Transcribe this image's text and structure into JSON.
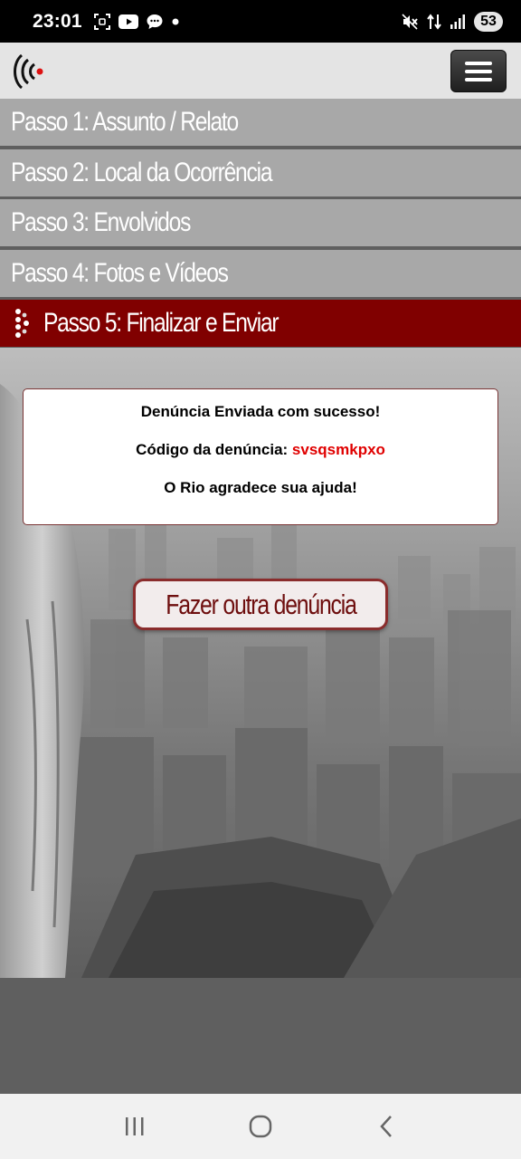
{
  "status_bar": {
    "time": "23:01",
    "battery": "53",
    "icons_left": [
      "screenshot-icon",
      "youtube-icon",
      "chat-icon",
      "dot-icon"
    ],
    "icons_right": [
      "mute-icon",
      "data-arrows-icon",
      "signal-icon",
      "battery-icon"
    ]
  },
  "header": {
    "logo_icon": "sound-waves-logo-icon",
    "menu_icon": "hamburger-menu-icon"
  },
  "steps": [
    {
      "label": "Passo 1: Assunto / Relato",
      "active": false
    },
    {
      "label": "Passo 2: Local da Ocorrência",
      "active": false
    },
    {
      "label": "Passo 3: Envolvidos",
      "active": false
    },
    {
      "label": "Passo 4: Fotos e Vídeos",
      "active": false
    },
    {
      "label": "Passo 5: Finalizar e Enviar",
      "active": true
    }
  ],
  "message": {
    "success_text": "Denúncia Enviada com sucesso!",
    "code_label": "Código da denúncia:",
    "code_value": "svsqsmkpxo",
    "thanks_text": "O Rio agradece sua ajuda!"
  },
  "actions": {
    "another_report_label": "Fazer outra denúncia"
  },
  "nav_bar": {
    "icons": [
      "recent-apps-icon",
      "home-icon",
      "back-icon"
    ]
  },
  "colors": {
    "active_step": "#800000",
    "step_bg": "#a8a8a8",
    "code_color": "#e00000",
    "button_border": "#8a2c2c"
  }
}
